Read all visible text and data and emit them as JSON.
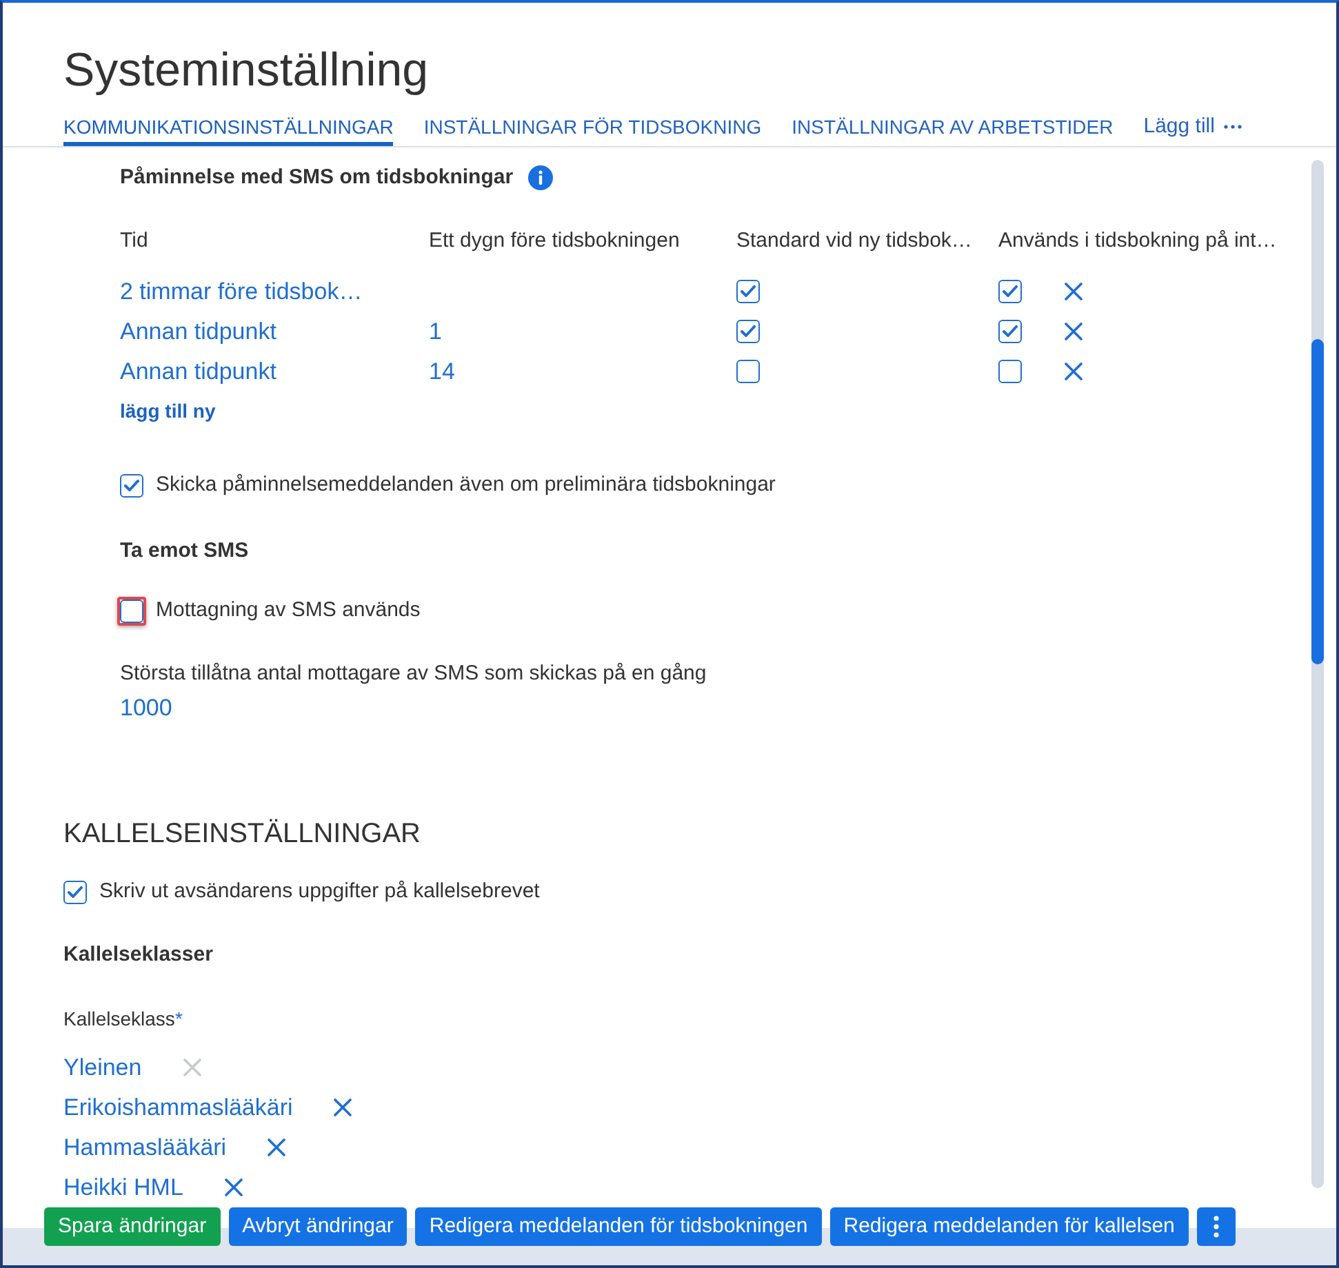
{
  "page": {
    "title": "Systeminställning"
  },
  "tabs": [
    {
      "label": "KOMMUNIKATIONSINSTÄLLNINGAR",
      "selected": true
    },
    {
      "label": "INSTÄLLNINGAR FÖR TIDSBOKNING",
      "selected": false
    },
    {
      "label": "INSTÄLLNINGAR AV ARBETSTIDER",
      "selected": false
    }
  ],
  "more_tab": {
    "label": "Lägg till"
  },
  "sms_reminders": {
    "heading": "Påminnelse med SMS om tidsbokningar",
    "columns": [
      "Tid",
      "Ett dygn före tidsbokningen",
      "Standard vid ny tidsbok…",
      "Används i tidsbokning på int…"
    ],
    "rows": [
      {
        "time": "2 timmar före tidsbok…",
        "standard": true,
        "online": true
      },
      {
        "time": "Annan tidpunkt",
        "days_before": "1",
        "standard": true,
        "online": true
      },
      {
        "time": "Annan tidpunkt",
        "days_before": "14",
        "standard": false,
        "online": false
      }
    ],
    "add_link": "lägg till ny",
    "preliminary": {
      "label": "Skicka påminnelsemeddelanden även om preliminära tidsbokningar",
      "checked": true
    }
  },
  "receive_sms": {
    "heading": "Ta emot SMS",
    "checkbox": {
      "label": "Mottagning av SMS används",
      "checked": false,
      "highlighted": true
    },
    "max_recipients": {
      "label": "Största tillåtna antal mottagare av SMS som skickas på en gång",
      "value": "1000"
    }
  },
  "letter_settings": {
    "heading": "KALLELSEINSTÄLLNINGAR",
    "checkbox": {
      "label": "Skriv ut avsändarens uppgifter på kallelsebrevet",
      "checked": true
    },
    "classes_heading": "Kallelseklasser",
    "field_label": "Kallelseklass",
    "required_mark": "*",
    "classes": [
      {
        "name": "Yleinen",
        "removable": false
      },
      {
        "name": "Erikoishammaslääkäri",
        "removable": true
      },
      {
        "name": "Hammaslääkäri",
        "removable": true
      },
      {
        "name": "Heikki HML",
        "removable": true
      }
    ]
  },
  "actions": [
    {
      "label": "Spara ändringar",
      "kind": "success"
    },
    {
      "label": "Avbryt ändringar",
      "kind": "primary"
    },
    {
      "label": "Redigera meddelanden för tidsbokningen",
      "kind": "primary"
    },
    {
      "label": "Redigera meddelanden för kallelsen",
      "kind": "primary"
    },
    {
      "kind": "menu"
    }
  ]
}
